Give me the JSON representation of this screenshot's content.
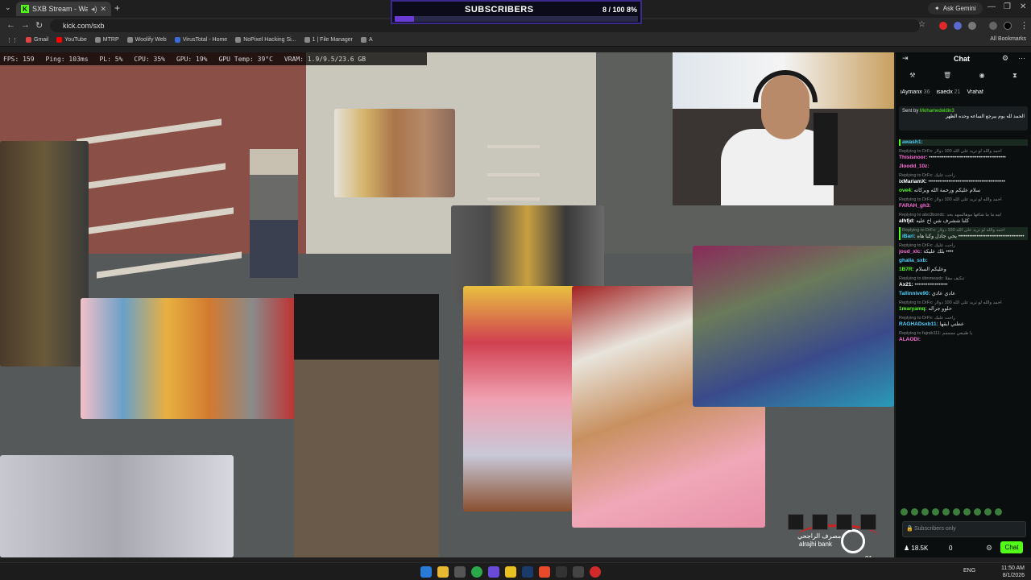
{
  "browser": {
    "tab_title": "SXB Stream - Watch Live on",
    "tab_favicon": "K",
    "gemini_label": "Ask Gemini",
    "url": "kick.com/sxb",
    "bookmarks": [
      "Gmail",
      "YouTube",
      "MTRP",
      "Woolify Web",
      "VirusTotal - Home",
      "NoPixel Hacking Si...",
      "1 | File Manager",
      "A"
    ],
    "all_bookmarks": "All Bookmarks"
  },
  "goal": {
    "title": "SUBSCRIBERS",
    "count": "8 / 100",
    "percent_label": "8%",
    "progress": 0.08
  },
  "hud": {
    "fps": "FPS: 159",
    "ping": "Ping: 103ms",
    "pl": "PL: 5%",
    "cpu": "CPU: 35%",
    "gpu": "GPU: 19%",
    "gpu_temp": "GPU Temp: 39°C",
    "vram": "VRAM: 1.9/9.5/23.6 GB"
  },
  "game": {
    "bank_name_ar": "مصرف الراجحي",
    "bank_name_en": "alrajhi bank",
    "hud_number": "81"
  },
  "chat": {
    "title": "Chat",
    "leaders": [
      {
        "name": "iAymanx",
        "count": "36"
      },
      {
        "name": "isaedx",
        "count": "21"
      },
      {
        "name": "Vrahaf",
        "count": ""
      }
    ],
    "pinned": {
      "sent_by": "Sent by",
      "from": "Mohamedeldin3",
      "text": "الحمد لله يوم بيرجع الساعه وحده الظهر"
    },
    "messages": [
      {
        "reply": "",
        "user": "awash1:",
        "color": "#4fd1ff",
        "body": "",
        "hl": true
      },
      {
        "reply": "Replying to DrFx: احمد والله لو تريد على الله 100 دولار",
        "user": "Thisisnoor:",
        "color": "#ff6fd8",
        "body": "••••••••••••••••••••••••••••••••••••••••••",
        "hl": false
      },
      {
        "reply": "",
        "user": "Jloodd_10z:",
        "color": "#ff6fd8",
        "body": "",
        "hl": false
      },
      {
        "reply": "Replying to DrFx: راحت عليك",
        "user": "ixMariamX:",
        "color": "#ffffff",
        "body": "••••••••••••••••••••••••••••••••••••••••••",
        "hl": false
      },
      {
        "reply": "",
        "user": "ove4:",
        "color": "#53fc18",
        "body": "سلام عليكم ورحمة الله وبركاته",
        "hl": false
      },
      {
        "reply": "Replying to DrFx: احمد والله لو تريد على الله 100 دولار",
        "user": "FARAH_gh3:",
        "color": "#ff6fd8",
        "body": "",
        "hl": false
      },
      {
        "reply": "Replying to abo3bondc: امه ما ما شافها موهالسهد بحد",
        "user": "alhfjd:",
        "color": "#ffffff",
        "body": "كلنا ششرف شن اخ عليه",
        "hl": false
      },
      {
        "reply": "Replying to DrFx: احمد والله لو تريد على الله 100 دولار",
        "user": "iBari:",
        "color": "#4fd1ff",
        "body": "يحي جادل وكبا هاه ••••••••••••••••••••••••••••••••••••",
        "hl": true
      },
      {
        "reply": "Replying to DrFx: راحت عليك",
        "user": "joud_xlc:",
        "color": "#ff6fd8",
        "body": "بلك عليكة ••••",
        "hl": false
      },
      {
        "reply": "",
        "user": "ghalia_sxb:",
        "color": "#4fd1ff",
        "body": "",
        "hl": false
      },
      {
        "reply": "",
        "user": "1B7R:",
        "color": "#53fc18",
        "body": "وعليكم السلام",
        "hl": false
      },
      {
        "reply": "Replying to iibnmeaxb: تنكيف مقلا",
        "user": "Ax21:",
        "color": "#ffffff",
        "body": "••••••••••••••••••",
        "hl": false
      },
      {
        "reply": "",
        "user": "Tallinnive90:",
        "color": "#4fd1ff",
        "body": "عادي عادي",
        "hl": false
      },
      {
        "reply": "Replying to DrFx: احمد والله لو تريد على الله 100 دولار",
        "user": "1maryamq:",
        "color": "#53fc18",
        "body": "حلوو جراله",
        "hl": false
      },
      {
        "reply": "Replying to DrFx: راحت عليك",
        "user": "RAGHADsxb11:",
        "color": "#4fd1ff",
        "body": "عطني ايقها",
        "hl": false
      },
      {
        "reply": "Replying to fajrsb111: يا ظبيعي ممممم",
        "user": "ALAODi:",
        "color": "#ff6fd8",
        "body": "",
        "hl": false
      }
    ],
    "input_placeholder": "Subscribers only",
    "viewers": "18.5K",
    "zero": "0",
    "chat_button": "Chat"
  },
  "taskbar": {
    "lang": "ENG",
    "time": "11:50 AM",
    "date": "8/1/2026"
  },
  "colors": {
    "kick_green": "#53fc18",
    "goal_fill": "#6b3bd6"
  }
}
